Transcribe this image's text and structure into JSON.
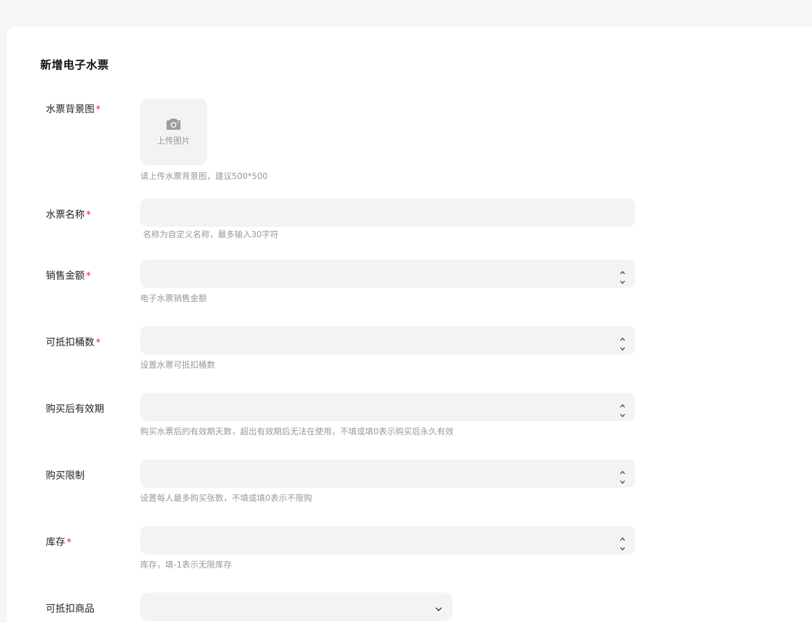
{
  "form": {
    "title": "新增电子水票",
    "required_mark": "*",
    "background_image": {
      "label": "水票背景图",
      "required": true,
      "upload_text": "上传图片",
      "hint": "请上传水票背景图，建议500*500"
    },
    "name": {
      "label": "水票名称",
      "required": true,
      "value": "",
      "hint": "名称为自定义名称，最多输入30字符"
    },
    "sale_amount": {
      "label": "销售金额",
      "required": true,
      "value": "",
      "hint": "电子水票销售金额"
    },
    "deductible_buckets": {
      "label": "可抵扣桶数",
      "required": true,
      "value": "",
      "hint": "设置水票可抵扣桶数"
    },
    "validity": {
      "label": "购买后有效期",
      "required": false,
      "value": "",
      "hint": "购买水票后的有效期天数，超出有效期后无法在使用，不填或填0表示购买后永久有效"
    },
    "purchase_limit": {
      "label": "购买限制",
      "required": false,
      "value": "",
      "hint": "设置每人最多购买张数，不填或填0表示不限购"
    },
    "stock": {
      "label": "库存",
      "required": true,
      "value": "",
      "hint": "库存，填-1表示无限库存"
    },
    "deductible_goods": {
      "label": "可抵扣商品",
      "required": false,
      "selected": ""
    }
  },
  "icons": {
    "upload": "camera-icon",
    "stepper_up": "chevron-up-icon",
    "stepper_down": "chevron-down-icon",
    "select": "chevron-down-icon"
  },
  "colors": {
    "required": "#f5222d",
    "input_bg": "#f3f3f3",
    "hint": "#999999",
    "page_bg": "#f5f6f8"
  }
}
